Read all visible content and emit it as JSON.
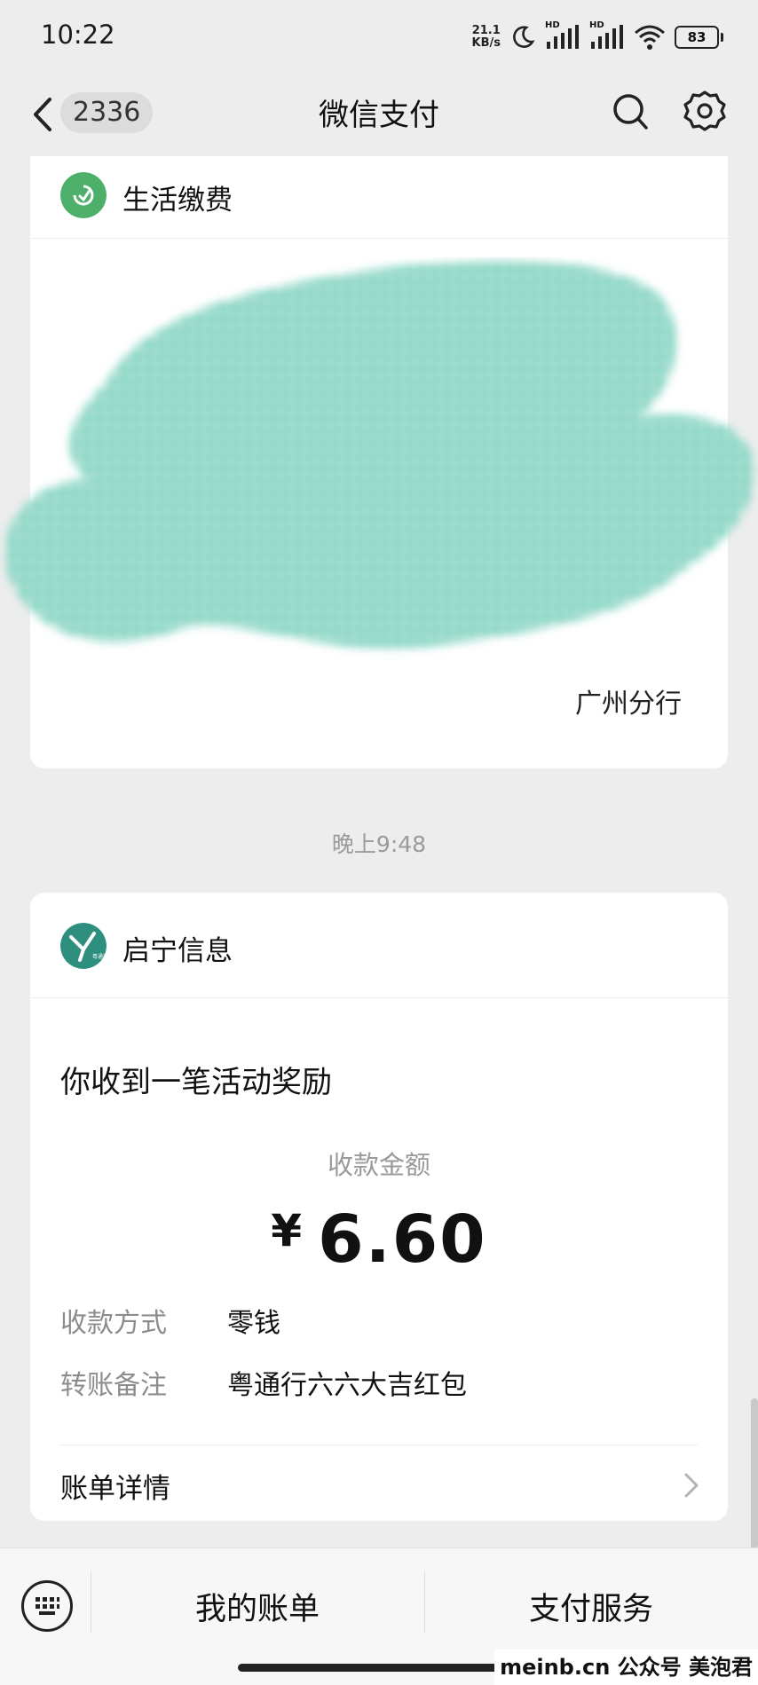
{
  "status_bar": {
    "time": "10:22",
    "network_speed_value": "21.1",
    "network_speed_unit": "KB/s",
    "signal1_label": "HD",
    "signal2_label": "HD",
    "battery": "83"
  },
  "nav": {
    "unread_count": "2336",
    "title": "微信支付"
  },
  "card_life": {
    "service_name": "生活缴费",
    "partial_text": "广州分行",
    "accent_color": "#4caf6a"
  },
  "timestamp": "晚上9:48",
  "card_reward": {
    "sender": "启宁信息",
    "avatar_text": "粤通行",
    "notice": "你收到一笔活动奖励",
    "amount_label": "收款金额",
    "currency": "¥",
    "amount": "6.60",
    "rows": [
      {
        "key": "收款方式",
        "value": "零钱"
      },
      {
        "key": "转账备注",
        "value": "粤通行六六大吉红包"
      }
    ],
    "detail_label": "账单详情"
  },
  "bottom_bar": {
    "tab1": "我的账单",
    "tab2": "支付服务"
  },
  "watermark": "meinb.cn  公众号 美泡君"
}
